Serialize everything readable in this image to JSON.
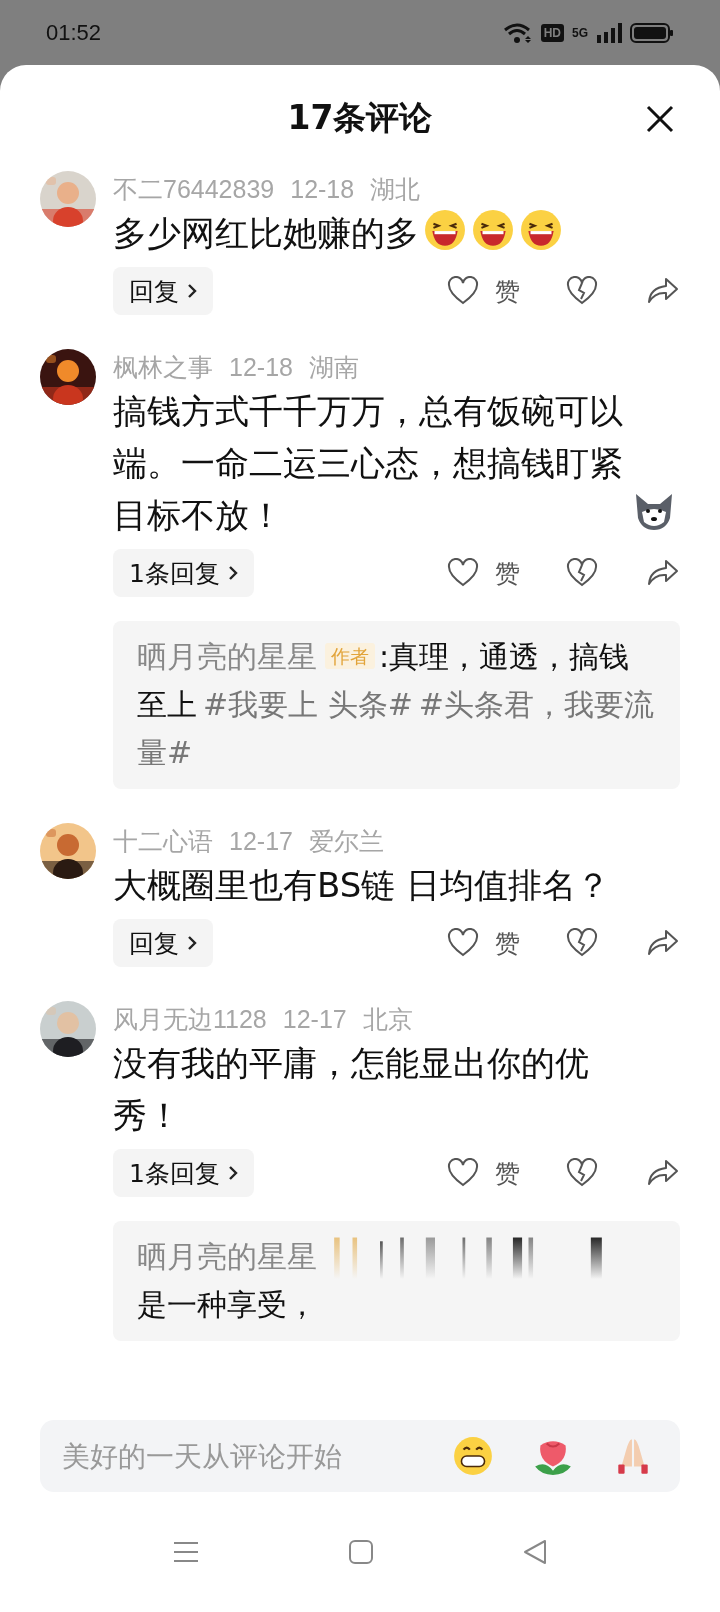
{
  "status_bar": {
    "time": "01:52",
    "badges": [
      "HD",
      "5G"
    ]
  },
  "header": {
    "title": "17条评论"
  },
  "comments": [
    {
      "user": "不二76442839",
      "date": "12-18",
      "location": "湖北",
      "text": "多少网红比她赚的多",
      "emojis": [
        {
          "kind": "laugh"
        },
        {
          "kind": "laugh"
        },
        {
          "kind": "laugh"
        }
      ],
      "reply_button": "回复",
      "like_label": "赞"
    },
    {
      "user": "枫林之事",
      "date": "12-18",
      "location": "湖南",
      "text": "搞钱方式千千万万，总有饭碗可以端。一命二运三心态，想搞钱盯紧目标不放！",
      "emojis": [
        {
          "kind": "husky"
        }
      ],
      "reply_button": "1条回复",
      "like_label": "赞",
      "replies": [
        {
          "author": "晒月亮的星星",
          "badge": "作者",
          "obscured": false,
          "segments": [
            {
              "kind": "text",
              "text": ":真理，通透，搞钱至上"
            },
            {
              "kind": "tag",
              "text": "#我要上 头条#"
            },
            {
              "kind": "tag",
              "text": "#头条君，我要流量#"
            }
          ]
        }
      ]
    },
    {
      "user": "十二心语",
      "date": "12-17",
      "location": "爱尔兰",
      "text": "大概圈里也有BS链 日均值排名？",
      "reply_button": "回复",
      "like_label": "赞"
    },
    {
      "user": "风月无边1128",
      "date": "12-17",
      "location": "北京",
      "text": "没有我的平庸，怎能显出你的优秀！",
      "reply_button": "1条回复",
      "like_label": "赞",
      "replies": [
        {
          "author": "晒月亮的星星",
          "obscured": true,
          "segments": [
            {
              "kind": "text",
              "text": "是一种享受，"
            }
          ]
        }
      ]
    }
  ],
  "input": {
    "placeholder": "美好的一天从评论开始",
    "emojis": [
      {
        "kind": "grin"
      },
      {
        "kind": "rose"
      },
      {
        "kind": "pray"
      }
    ]
  }
}
